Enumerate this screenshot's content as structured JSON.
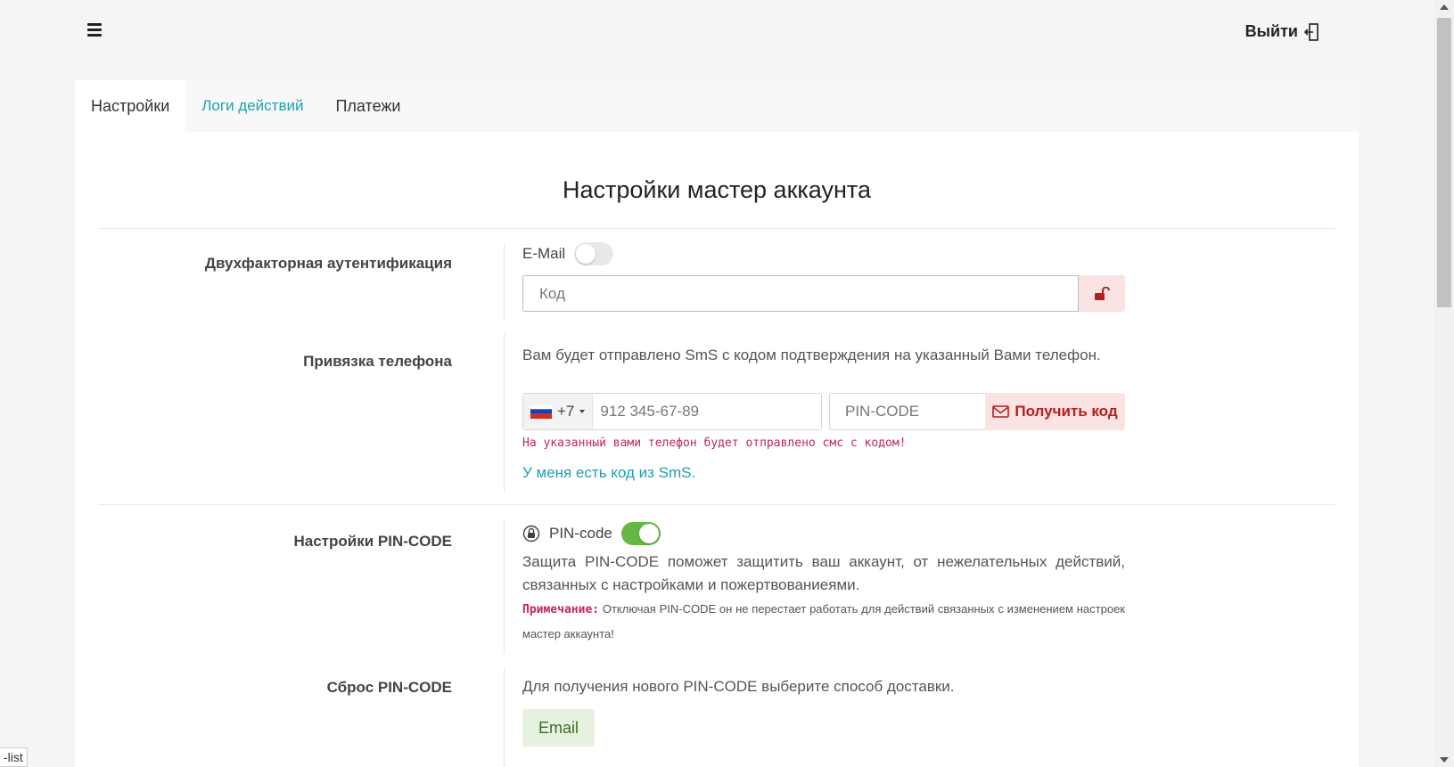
{
  "header": {
    "logout_label": "Выйти"
  },
  "tabs": [
    {
      "label": "Настройки"
    },
    {
      "label": "Логи действий"
    },
    {
      "label": "Платежи"
    }
  ],
  "page_title": "Настройки мастер аккаунта",
  "two_factor": {
    "label": "Двухфакторная аутентификация",
    "email_label": "E-Mail",
    "email_enabled": false,
    "code_placeholder": "Код"
  },
  "phone": {
    "label": "Привязка телефона",
    "description": "Вам будет отправлено SmS с кодом подтверждения на указанный Вами телефон.",
    "country_code": "+7",
    "phone_placeholder": "912 345-67-89",
    "pin_placeholder": "PIN-CODE",
    "get_code_label": "Получить код",
    "hint": "На указанный вами телефон будет отправлено смс с кодом!",
    "have_code_link": "У меня есть код из SmS."
  },
  "pin_settings": {
    "label": "Настройки PIN-CODE",
    "toggle_label": "PIN-code",
    "enabled": true,
    "description": "Защита PIN-CODE поможет защитить ваш аккаунт, от нежелательных действий, связанных с настройками и пожертвованиеями.",
    "note_prefix": "Примечание:",
    "note_text": " Отключая PIN-CODE он не перестает работать для действий связанных с изменением настроек мастер аккаунта!"
  },
  "pin_reset": {
    "label": "Сброс PIN-CODE",
    "description": "Для получения нового PIN-CODE выберите способ доставки.",
    "email_button": "Email"
  },
  "status_fragment": "-list",
  "colors": {
    "accent": "#1fa0b0",
    "danger": "#b21f1f",
    "success": "#66b845"
  }
}
